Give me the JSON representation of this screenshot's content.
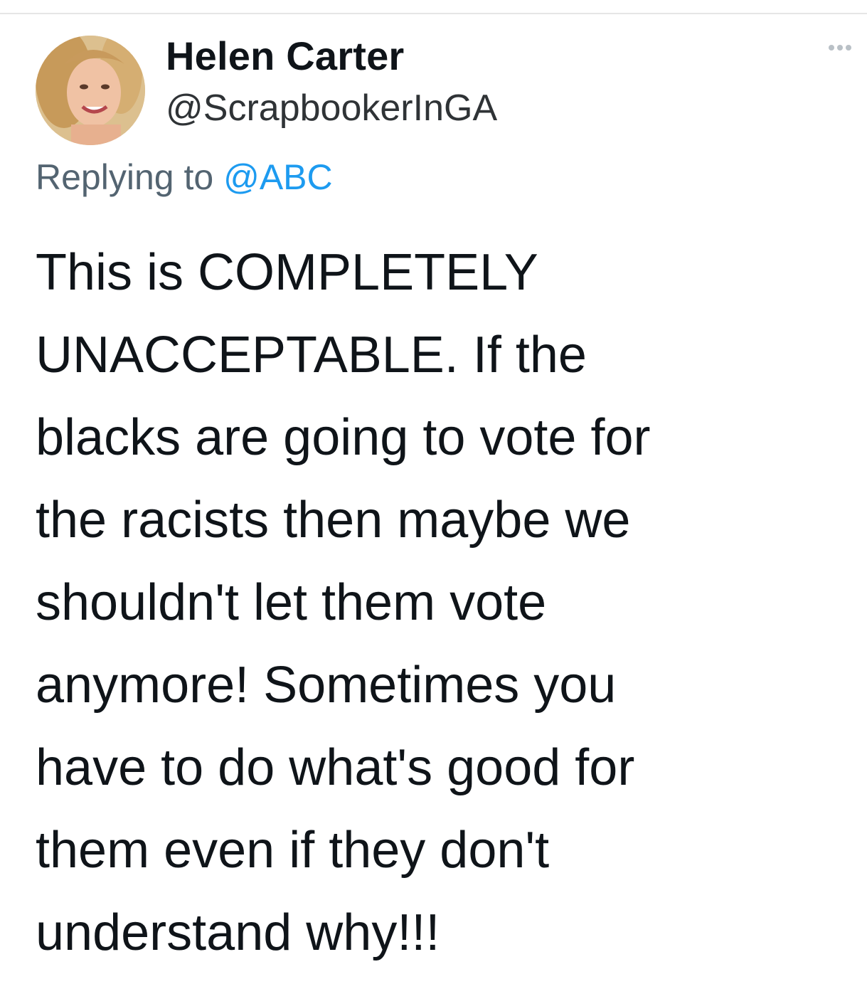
{
  "tweet": {
    "author": {
      "display_name": "Helen Carter",
      "handle": "@ScrapbookerInGA",
      "avatar": "profile-photo"
    },
    "more_icon": "more-icon",
    "reply": {
      "prefix": "Replying to",
      "mention": "@ABC"
    },
    "text_lines": [
      "This is COMPLETELY",
      "UNACCEPTABLE. If the",
      "blacks are going to vote for",
      "the racists then maybe we",
      "shouldn't let them vote",
      "anymore! Sometimes you",
      "have to do what's good for",
      "them even if they don't",
      "understand why!!!"
    ]
  },
  "colors": {
    "text": "#0f1419",
    "secondary": "#536471",
    "link": "#1d9bf0"
  }
}
